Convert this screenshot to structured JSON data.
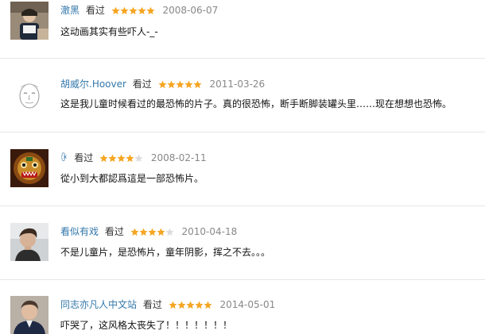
{
  "comments": [
    {
      "user": "澈黑",
      "action": "看过",
      "rating": 5,
      "date": "2008-06-07",
      "text": "这动画其实有些吓人-_-",
      "avatar": "person-reading-avatar"
    },
    {
      "user": "胡威尔.Hoover",
      "action": "看过",
      "rating": 5,
      "date": "2011-03-26",
      "text": "这是我儿童时候看过的最恐怖的片子。真的很恐怖，断手断脚装罐头里……现在想想也恐怖。",
      "avatar": "sketch-face-avatar"
    },
    {
      "user": "ꀖ",
      "action": "看过",
      "rating": 4,
      "date": "2008-02-11",
      "text": "從小到大都認爲這是一部恐怖片。",
      "avatar": "lion-mask-avatar"
    },
    {
      "user": "看似有戏",
      "action": "看过",
      "rating": 4,
      "date": "2010-04-18",
      "text": "不是儿童片，是恐怖片，童年阴影，挥之不去。。。",
      "avatar": "portrait-avatar"
    },
    {
      "user": "同志亦凡人中文站",
      "action": "看过",
      "rating": 5,
      "date": "2014-05-01",
      "text": "吓哭了，这风格太丧失了！！！！！！！",
      "avatar": "man-portrait-avatar"
    }
  ],
  "colors": {
    "username": "#3377aa",
    "star_filled": "#f5a623",
    "star_empty": "#dddddd",
    "date": "#888888",
    "divider": "#e6e6e6"
  }
}
